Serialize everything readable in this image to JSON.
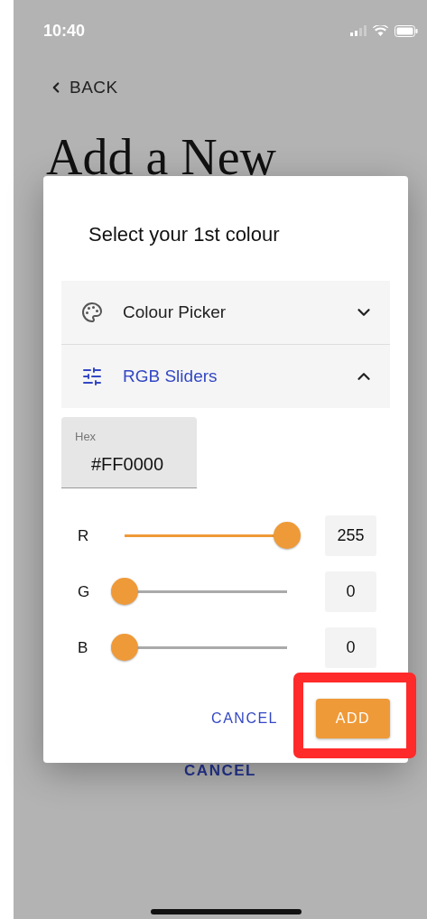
{
  "status_bar": {
    "time": "10:40"
  },
  "back": {
    "label": "BACK"
  },
  "page_title": "Add a New",
  "page_cancel": "CANCEL",
  "dialog": {
    "title": "Select your 1st colour",
    "sections": [
      {
        "label": "Colour Picker",
        "expanded": false
      },
      {
        "label": "RGB Sliders",
        "expanded": true
      }
    ],
    "hex": {
      "label": "Hex",
      "value": "#FF0000"
    },
    "sliders": [
      {
        "label": "R",
        "level": 1,
        "reading": "255"
      },
      {
        "label": "G",
        "level": 0,
        "reading": "0"
      },
      {
        "label": "B",
        "level": 0,
        "reading": "0"
      }
    ],
    "buttons": [
      {
        "label": "CANCEL",
        "kind": "text",
        "highlighted": false
      },
      {
        "label": "ADD",
        "kind": "primary",
        "highlighted": true
      }
    ]
  }
}
